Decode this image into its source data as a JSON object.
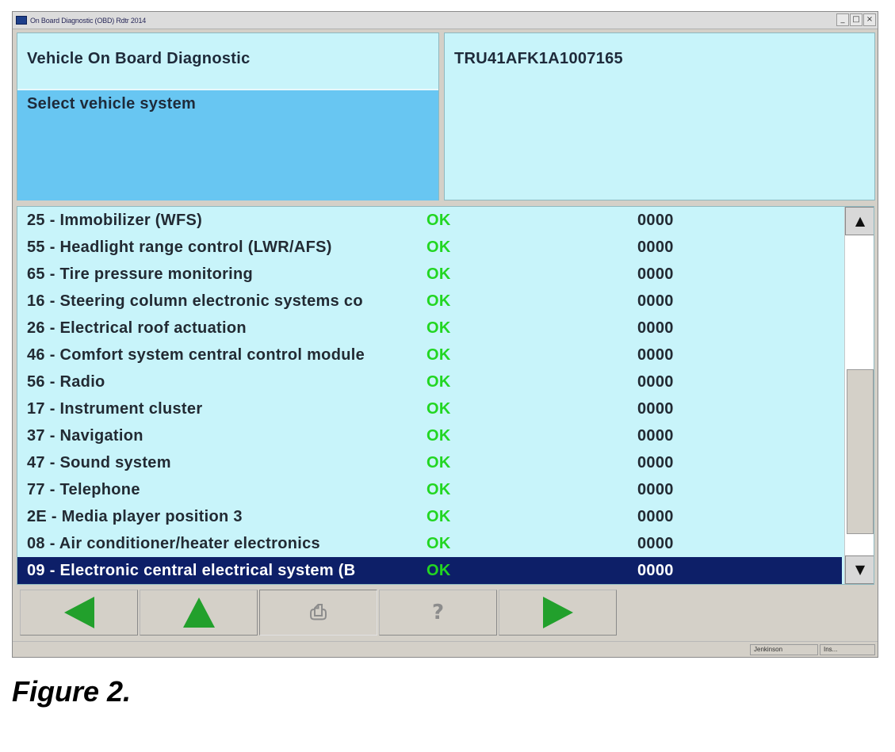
{
  "window": {
    "title": "On Board Diagnostic (OBD) Rdtr 2014",
    "controls": {
      "minimize": "_",
      "maximize": "□",
      "close": "×"
    }
  },
  "header": {
    "title": "Vehicle On Board Diagnostic",
    "subtitle": "Select vehicle system",
    "vin": "TRU41AFK1A1007165"
  },
  "systems": [
    {
      "name": "25 - Immobilizer (WFS)",
      "status": "OK",
      "code": "0000"
    },
    {
      "name": "55 - Headlight range control (LWR/AFS)",
      "status": "OK",
      "code": "0000"
    },
    {
      "name": "65 - Tire pressure monitoring",
      "status": "OK",
      "code": "0000"
    },
    {
      "name": "16 - Steering column electronic systems co",
      "status": "OK",
      "code": "0000"
    },
    {
      "name": "26 - Electrical roof actuation",
      "status": "OK",
      "code": "0000"
    },
    {
      "name": "46 - Comfort system central control module",
      "status": "OK",
      "code": "0000"
    },
    {
      "name": "56 - Radio",
      "status": "OK",
      "code": "0000"
    },
    {
      "name": "17 - Instrument cluster",
      "status": "OK",
      "code": "0000"
    },
    {
      "name": "37 - Navigation",
      "status": "OK",
      "code": "0000"
    },
    {
      "name": "47 - Sound system",
      "status": "OK",
      "code": "0000"
    },
    {
      "name": "77 - Telephone",
      "status": "OK",
      "code": "0000"
    },
    {
      "name": "2E - Media player position 3",
      "status": "OK",
      "code": "0000"
    },
    {
      "name": "08 - Air conditioner/heater electronics",
      "status": "OK",
      "code": "0000"
    },
    {
      "name": "09 - Electronic central electrical system (B",
      "status": "OK",
      "code": "0000",
      "selected": true
    }
  ],
  "scrollbar": {
    "up_glyph": "▲",
    "down_glyph": "▼"
  },
  "toolbar": {
    "buttons": [
      {
        "name": "back-button",
        "icon": "left-arrow-icon"
      },
      {
        "name": "up-button",
        "icon": "up-arrow-icon"
      },
      {
        "name": "print-button",
        "icon": "printer-icon"
      },
      {
        "name": "help-button",
        "icon": "help-icon"
      },
      {
        "name": "forward-button",
        "icon": "right-arrow-icon"
      }
    ]
  },
  "statusbar": {
    "cell1": "Jenkinson",
    "cell2": "Ins..."
  },
  "caption": "Figure 2.",
  "colors": {
    "panel_bg": "#c8f4fa",
    "subtitle_bg": "#68c6f2",
    "selected_row_bg": "#0d1f68",
    "status_ok": "#22d622",
    "arrow_green": "#22a02c"
  }
}
